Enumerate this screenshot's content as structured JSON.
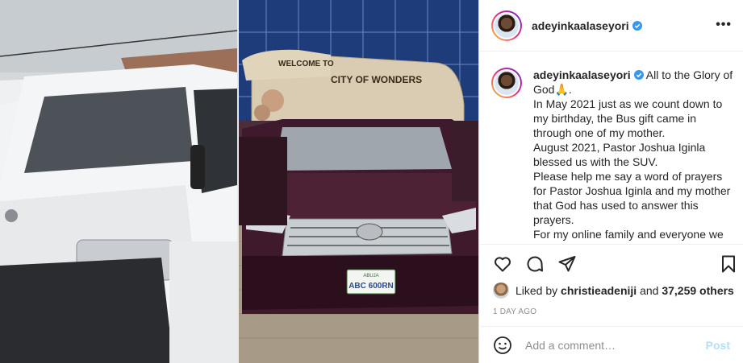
{
  "post": {
    "username": "adeyinkaalaseyori",
    "verified": true,
    "caption_lines": [
      "All to the Glory of God🙏.",
      "In May 2021 just as we count down to my birthday, the Bus gift came in through one of my mother.",
      "August 2021, Pastor Joshua Iginla blessed us with the SUV.",
      "Please help me say a word of prayers for Pastor Joshua Iginla and my mother that God has used to answer this prayers.",
      "For my online family and everyone we"
    ],
    "likes_prefix": "Liked by ",
    "liked_by_user": "christieadeniji",
    "likes_joiner": " and ",
    "likes_count": "37,259 others",
    "time_ago": "1 DAY AGO",
    "comment_placeholder": "Add a comment…",
    "post_label": "Post"
  },
  "photo": {
    "arch_welcome": "WELCOME TO",
    "arch_city": "CITY OF WONDERS",
    "plate_top": "ABUJA",
    "plate_number": "ABC 600RN"
  },
  "icons": {
    "like": "heart-icon",
    "comment": "comment-icon",
    "share": "share-icon",
    "save": "bookmark-icon",
    "emoji": "smile-icon",
    "more": "more-options-icon"
  },
  "colors": {
    "verified": "#3897f0",
    "post_disabled": "#b2dffc",
    "muted": "#8e8e8e"
  }
}
